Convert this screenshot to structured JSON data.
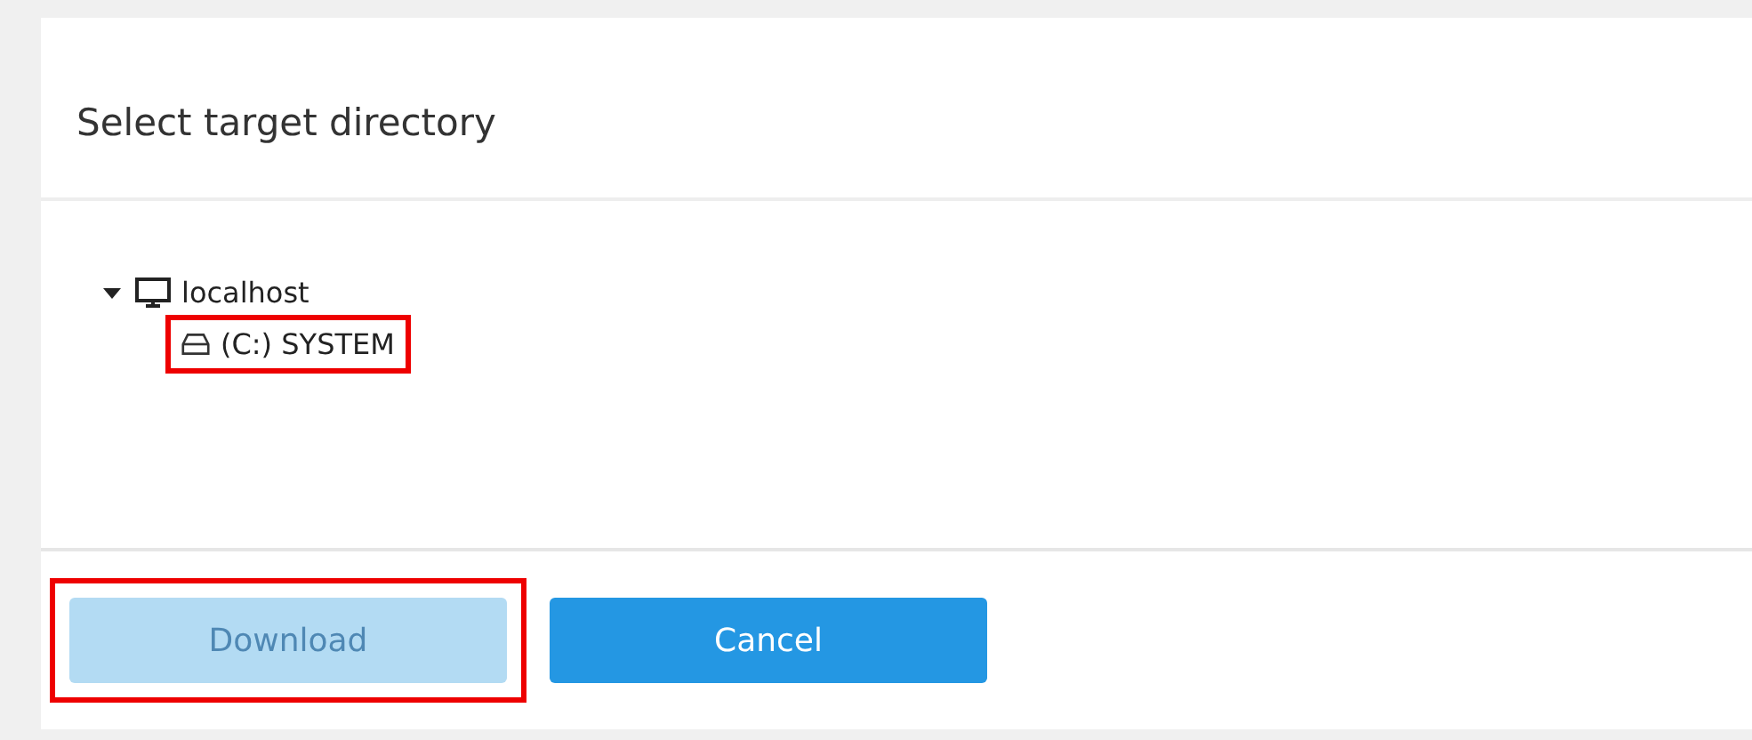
{
  "dialog": {
    "title": "Select target directory"
  },
  "tree": [
    {
      "label": "localhost",
      "kind": "computer",
      "expanded": true,
      "highlighted": false,
      "children": [
        {
          "label": "(C:) SYSTEM",
          "kind": "drive",
          "highlighted": true
        }
      ]
    }
  ],
  "buttons": [
    {
      "label": "Download",
      "disabled": true,
      "highlighted": true
    },
    {
      "label": "Cancel",
      "disabled": false,
      "highlighted": false
    }
  ]
}
